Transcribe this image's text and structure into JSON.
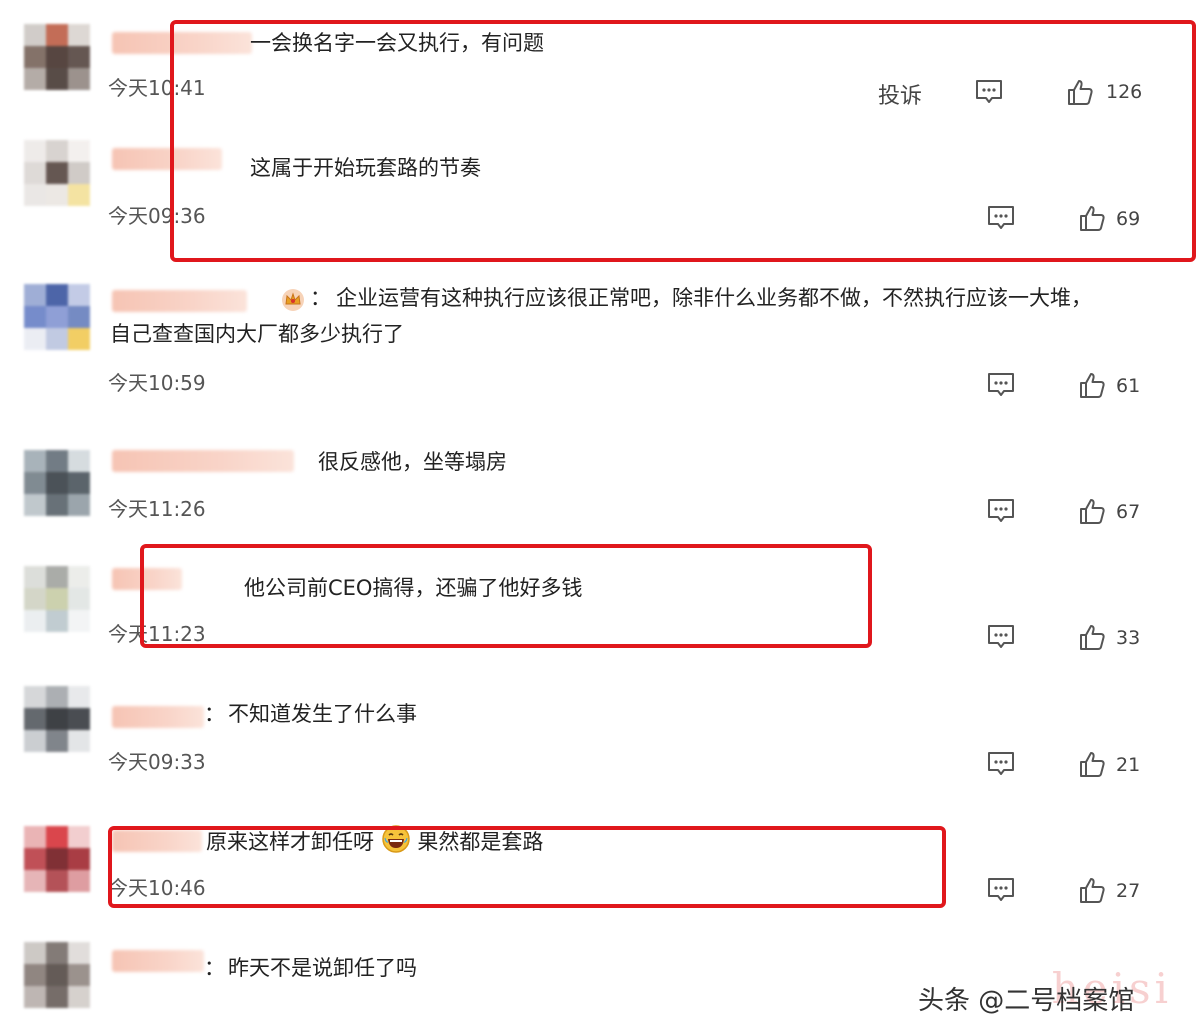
{
  "comments": [
    {
      "text": "一会换名字一会又执行，有问题",
      "time": "今天10:41",
      "report": "投诉",
      "likes": "126"
    },
    {
      "text": "这属于开始玩套路的节奏",
      "time": "今天09:36",
      "likes": "69"
    },
    {
      "prefix": "：",
      "text": "企业运营有这种执行应该很正常吧，除非什么业务都不做，不然执行应该一大堆，",
      "text2": "自己查查国内大厂都多少执行了",
      "time": "今天10:59",
      "likes": "61"
    },
    {
      "text": "很反感他，坐等塌房",
      "time": "今天11:26",
      "likes": "67"
    },
    {
      "text": "他公司前CEO搞得，还骗了他好多钱",
      "time": "今天11:23",
      "likes": "33"
    },
    {
      "prefix": "：",
      "text": "不知道发生了什么事",
      "time": "今天09:33",
      "likes": "21"
    },
    {
      "text": "原来这样才卸任呀",
      "text2": "果然都是套路",
      "time": "今天10:46",
      "likes": "27"
    },
    {
      "prefix": "：",
      "text": "昨天不是说卸任了吗"
    }
  ],
  "watermark": "heisi",
  "source": "头条 @二号档案馆",
  "colors": {
    "highlight": "#e0171c",
    "text": "#222222",
    "meta": "#555555"
  },
  "icons": {
    "reply": "comment-bubble-icon",
    "like": "thumbs-up-icon",
    "crown": "crown-badge-icon",
    "laugh": "laughing-emoji-icon"
  }
}
